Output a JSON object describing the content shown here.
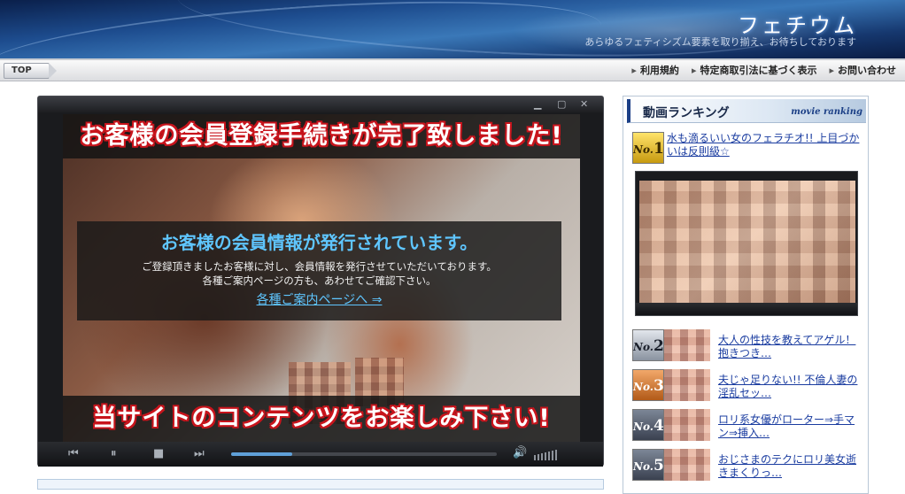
{
  "header": {
    "logo": "フェチウム",
    "tagline": "あらゆるフェティシズム要素を取り揃え、お待ちしております"
  },
  "nav": {
    "top": "TOP",
    "links": [
      "利用規約",
      "特定商取引法に基づく表示",
      "お問い合わせ"
    ]
  },
  "player": {
    "headline_top": "お客様の会員登録手続きが完了致しました!",
    "info_title": "お客様の会員情報が発行されています。",
    "info_line1": "ご登録頂きましたお客様に対し、会員情報を発行させていただいております。",
    "info_line2": "各種ご案内ページの方も、あわせてご確認下さい。",
    "info_link": "各種ご案内ページへ ⇒",
    "headline_bottom": "当サイトのコンテンツをお楽しみ下さい!",
    "progress": 0.23
  },
  "ranking": {
    "title": "動画ランキング",
    "subtitle": "movie ranking",
    "items": [
      {
        "badge": "No.",
        "num": "1",
        "title": "水も滴るいい女のフェラチオ!! 上目づかいは反則級☆"
      },
      {
        "badge": "No.",
        "num": "2",
        "title": "大人の性技を教えてアゲル！ 抱きつき…"
      },
      {
        "badge": "No.",
        "num": "3",
        "title": "夫じゃ足りない!! 不倫人妻の淫乱セッ…"
      },
      {
        "badge": "No.",
        "num": "4",
        "title": "ロリ系女優がローター⇒手マン⇒挿入…"
      },
      {
        "badge": "No.",
        "num": "5",
        "title": "おじさまのテクにロリ美女逝きまくりっ…"
      }
    ]
  }
}
